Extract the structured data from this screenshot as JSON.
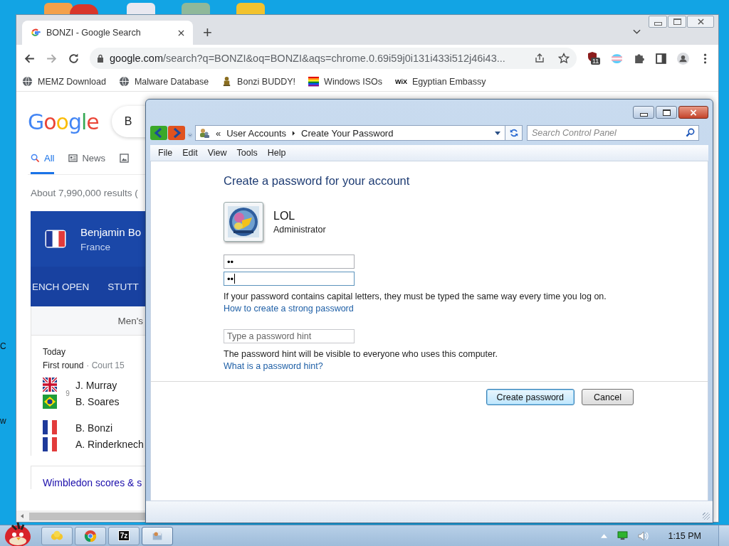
{
  "desktop": {
    "label_fragments": [
      "C",
      "w"
    ]
  },
  "browser": {
    "tab": {
      "title": "BONZI - Google Search"
    },
    "new_tab": "+",
    "url_host": "google.com",
    "url_path": "/search?q=BONZI&oq=BONZI&aqs=chrome.0.69i59j0i131i433i512j46i43...",
    "extension_badge": "11",
    "bookmarks": [
      {
        "label": "MEMZ Download",
        "kind": "globe"
      },
      {
        "label": "Malware Database",
        "kind": "globe"
      },
      {
        "label": "Bonzi BUDDY!",
        "kind": "figure"
      },
      {
        "label": "Windows ISOs",
        "kind": "rainbow"
      },
      {
        "label": "Egyptian Embassy",
        "kind": "wix",
        "icon_text": "WiX"
      }
    ]
  },
  "google": {
    "logo": "Google",
    "search_value": "B",
    "tabs": [
      {
        "label": "All",
        "kind": "search",
        "selected": true
      },
      {
        "label": "News",
        "kind": "news",
        "selected": false
      },
      {
        "kind": "images",
        "selected": false
      }
    ],
    "result_count": "About 7,990,000 results (",
    "card": {
      "player": "Benjamin Bo",
      "country": "France",
      "tournaments": [
        "ENCH OPEN",
        "STUTT"
      ],
      "draw": "Men's",
      "day": "Today",
      "round": "First round",
      "court": "· Court 15",
      "matches": [
        {
          "seed": "9",
          "players": [
            {
              "name": "J. Murray",
              "kind": "gb"
            },
            {
              "name": "B. Soares",
              "kind": "br"
            }
          ]
        },
        {
          "players": [
            {
              "name": "B. Bonzi",
              "kind": "fr"
            },
            {
              "name": "A. Rinderknech",
              "kind": "fr"
            }
          ]
        }
      ],
      "link": "Wimbledon scores & s"
    }
  },
  "control_panel": {
    "breadcrumb_prefix": "«",
    "breadcrumb": [
      "User Accounts",
      "Create Your Password"
    ],
    "search": {
      "placeholder": "Search Control Panel"
    },
    "menu": [
      "File",
      "Edit",
      "View",
      "Tools",
      "Help"
    ],
    "heading": "Create a password for your account",
    "account": {
      "name": "LOL",
      "role": "Administrator"
    },
    "password_fields": [
      {
        "value": "••",
        "focused": false
      },
      {
        "value": "••",
        "focused": true
      }
    ],
    "capital_note": "If your password contains capital letters, they must be typed the same way every time you log on.",
    "strong_link": "How to create a strong password",
    "hint_field": {
      "placeholder": "Type a password hint"
    },
    "hint_note": "The password hint will be visible to everyone who uses this computer.",
    "hint_link": "What is a password hint?",
    "buttons": [
      {
        "label": "Create password",
        "default": true
      },
      {
        "label": "Cancel",
        "default": false
      }
    ]
  },
  "taskbar": {
    "time": "1:15 PM",
    "apps": [
      {
        "kind": "folder",
        "selected": false
      },
      {
        "kind": "chrome",
        "selected": false
      },
      {
        "kind": "sevenzip",
        "icon_text": "7z",
        "selected": false
      },
      {
        "kind": "control",
        "selected": true
      }
    ]
  }
}
